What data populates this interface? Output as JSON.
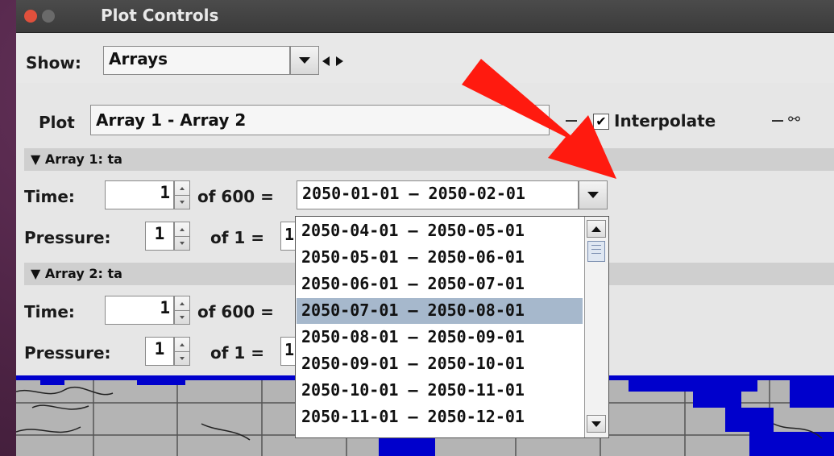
{
  "window": {
    "title": "Plot Controls"
  },
  "toolbar": {
    "show_label": "Show:",
    "show_value": "Arrays"
  },
  "plot": {
    "label": "Plot",
    "value": "Array 1 - Array 2",
    "interpolate_label": "Interpolate",
    "interpolate_checked": true
  },
  "array1": {
    "header": "▼ Array 1: ta",
    "time_label": "Time:",
    "time_value": "1",
    "time_of": "of 600 =",
    "time_range": "2050-01-01 — 2050-02-01",
    "pressure_label": "Pressure:",
    "pressure_value": "1",
    "pressure_of": "of 1 =",
    "pressure_range_partial": "1"
  },
  "array2": {
    "header": "▼ Array 2: ta",
    "time_label": "Time:",
    "time_value": "1",
    "time_of": "of 600 =",
    "pressure_label": "Pressure:",
    "pressure_value": "1",
    "pressure_of": "of 1 =",
    "pressure_range_partial": "1"
  },
  "dropdown": {
    "items": [
      "2050-04-01 — 2050-05-01",
      "2050-05-01 — 2050-06-01",
      "2050-06-01 — 2050-07-01",
      "2050-07-01 — 2050-08-01",
      "2050-08-01 — 2050-09-01",
      "2050-09-01 — 2050-10-01",
      "2050-10-01 — 2050-11-01",
      "2050-11-01 — 2050-12-01"
    ],
    "selected_index": 3
  },
  "colors": {
    "selection": "#a6b8cc",
    "annotation_arrow": "#ff1a0f",
    "map_water": "#0000cc",
    "map_land": "#b4b4b4"
  },
  "icons": {
    "link": "link-icon",
    "nav_prev": "triangle-left-icon",
    "nav_next": "triangle-right-icon"
  }
}
